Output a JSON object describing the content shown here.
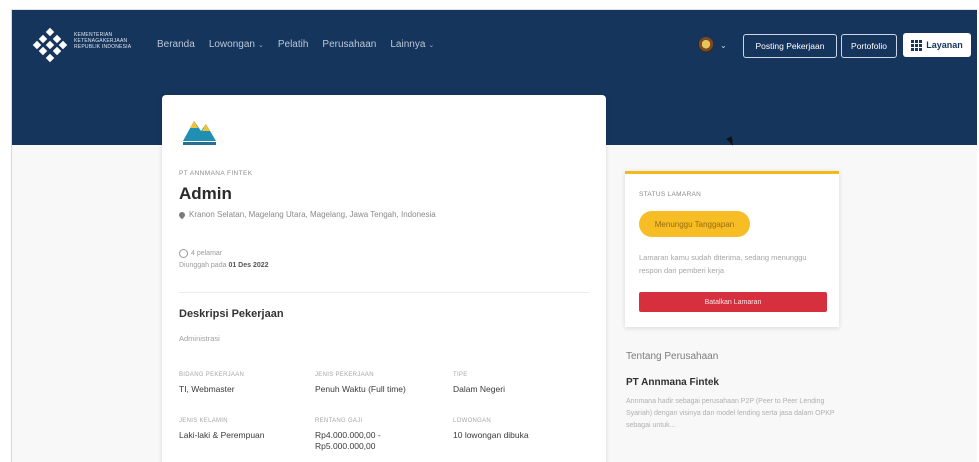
{
  "header": {
    "logo_lines": [
      "KEMENTERIAN",
      "KETENAGAKERJAAN",
      "REPUBLIK INDONESIA"
    ],
    "nav": [
      {
        "label": "Beranda",
        "dropdown": false
      },
      {
        "label": "Lowongan",
        "dropdown": true
      },
      {
        "label": "Pelatih",
        "dropdown": false
      },
      {
        "label": "Perusahaan",
        "dropdown": false
      },
      {
        "label": "Lainnya",
        "dropdown": true
      }
    ],
    "posting_label": "Posting Pekerjaan",
    "portofolio_label": "Portofolio",
    "layanan_label": "Layanan"
  },
  "job": {
    "company_name": "PT ANNMANA FINTEK",
    "title": "Admin",
    "location": "Kranon Selatan, Magelang Utara, Magelang, Jawa Tengah, Indonesia",
    "applicants": "4 pelamar",
    "posted_prefix": "Diunggah pada",
    "posted_date": "01 Des 2022",
    "section_title": "Deskripsi Pekerjaan",
    "section_sub": "Administrasi",
    "details": [
      {
        "label": "BIDANG PEKERJAAN",
        "value": "TI, Webmaster"
      },
      {
        "label": "JENIS PEKERJAAN",
        "value": "Penuh Waktu (Full time)"
      },
      {
        "label": "TIPE",
        "value": "Dalam Negeri"
      },
      {
        "label": "JENIS KELAMIN",
        "value": "Laki-laki & Perempuan"
      },
      {
        "label": "RENTANG GAJI",
        "value": "Rp4.000.000,00 -\nRp5.000.000,00"
      },
      {
        "label": "LOWONGAN",
        "value": "10 lowongan dibuka"
      }
    ]
  },
  "status": {
    "label": "STATUS LAMARAN",
    "badge": "Menunggu Tanggapan",
    "description": "Lamaran kamu sudah diterima, sedang menunggu respon dari pemberi kerja",
    "cancel_label": "Batalkan Lamaran"
  },
  "about": {
    "heading": "Tentang Perusahaan",
    "company": "PT Annmana Fintek",
    "description": "Annmana hadir sebagai perusahaan P2P (Peer to Peer Lending Syariah) dengan visinya dan model lending serta jasa dalam OPKP sebagai untuk..."
  },
  "colors": {
    "header_bg": "#16355c",
    "status_accent": "#f3b81c",
    "badge": "#f6bd26",
    "cancel": "#d6303f"
  }
}
